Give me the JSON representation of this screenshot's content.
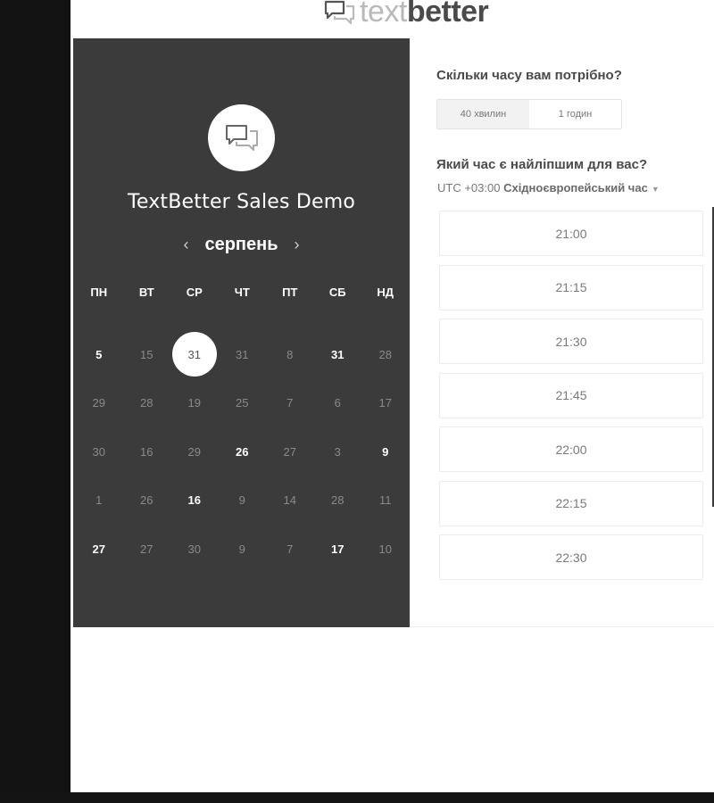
{
  "logo": {
    "text_light": "text",
    "text_dark": "better"
  },
  "event": {
    "title": "TextBetter Sales Demo"
  },
  "calendar": {
    "month": "серпень",
    "prev_icon": "‹",
    "next_icon": "›",
    "weekdays": [
      "ПН",
      "ВТ",
      "СР",
      "ЧТ",
      "ПТ",
      "СБ",
      "НД"
    ],
    "weeks": [
      [
        {
          "d": "5",
          "a": true
        },
        {
          "d": "15",
          "a": false
        },
        {
          "d": "31",
          "a": true,
          "s": true
        },
        {
          "d": "31",
          "a": false
        },
        {
          "d": "8",
          "a": false
        },
        {
          "d": "31",
          "a": true
        },
        {
          "d": "28",
          "a": false
        }
      ],
      [
        {
          "d": "29",
          "a": false
        },
        {
          "d": "28",
          "a": false
        },
        {
          "d": "19",
          "a": false
        },
        {
          "d": "25",
          "a": false
        },
        {
          "d": "7",
          "a": false
        },
        {
          "d": "6",
          "a": false
        },
        {
          "d": "17",
          "a": false
        }
      ],
      [
        {
          "d": "30",
          "a": false
        },
        {
          "d": "16",
          "a": false
        },
        {
          "d": "29",
          "a": false
        },
        {
          "d": "26",
          "a": true
        },
        {
          "d": "27",
          "a": false
        },
        {
          "d": "3",
          "a": false
        },
        {
          "d": "9",
          "a": true
        }
      ],
      [
        {
          "d": "1",
          "a": false
        },
        {
          "d": "26",
          "a": false
        },
        {
          "d": "16",
          "a": true
        },
        {
          "d": "9",
          "a": false
        },
        {
          "d": "14",
          "a": false
        },
        {
          "d": "28",
          "a": false
        },
        {
          "d": "11",
          "a": false
        }
      ],
      [
        {
          "d": "27",
          "a": true
        },
        {
          "d": "27",
          "a": false
        },
        {
          "d": "30",
          "a": false
        },
        {
          "d": "9",
          "a": false
        },
        {
          "d": "7",
          "a": false
        },
        {
          "d": "17",
          "a": true
        },
        {
          "d": "10",
          "a": false
        }
      ]
    ]
  },
  "duration": {
    "question": "Скільки часу вам потрібно?",
    "options": [
      "40 хвилин",
      "1 годин"
    ],
    "selected_index": 0
  },
  "time": {
    "question": "Який час є найліпшим для вас?",
    "timezone_offset": "UTC +03:00",
    "timezone_name": "Східноєвропейський час",
    "slots": [
      "21:00",
      "21:15",
      "21:30",
      "21:45",
      "22:00",
      "22:15",
      "22:30"
    ]
  }
}
